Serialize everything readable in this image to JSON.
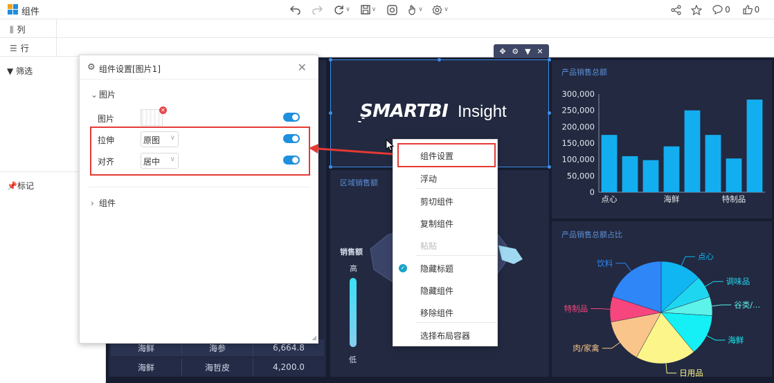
{
  "app": {
    "title": "组件"
  },
  "toolbar": {
    "icons": [
      "undo-icon",
      "redo-icon",
      "refresh-icon",
      "save-icon",
      "screenshot-icon",
      "gesture-icon",
      "settings-icon"
    ],
    "right": {
      "share_icon": "share-icon",
      "star_icon": "star-icon",
      "comments_count": "0",
      "likes_count": "0"
    }
  },
  "fields": {
    "columns_label": "列",
    "rows_label": "行"
  },
  "left_panel": {
    "filter_label": "筛选",
    "marker_label": "标记"
  },
  "dialog": {
    "title": "组件设置[图片1]",
    "section_image": "图片",
    "prop_image": "图片",
    "prop_stretch": "拉伸",
    "stretch_value": "原图",
    "prop_align": "对齐",
    "align_value": "居中",
    "section_component": "组件"
  },
  "context_menu": {
    "items": [
      {
        "label": "组件设置",
        "disabled": false,
        "checked": false
      },
      {
        "label": "浮动",
        "disabled": false,
        "checked": false
      },
      {
        "label": "剪切组件",
        "disabled": false,
        "checked": false
      },
      {
        "label": "复制组件",
        "disabled": false,
        "checked": false
      },
      {
        "label": "粘贴",
        "disabled": true,
        "checked": false
      },
      {
        "label": "隐藏标题",
        "disabled": false,
        "checked": true
      },
      {
        "label": "隐藏组件",
        "disabled": false,
        "checked": false
      },
      {
        "label": "移除组件",
        "disabled": false,
        "checked": false
      },
      {
        "label": "选择布局容器",
        "disabled": false,
        "checked": false
      }
    ]
  },
  "logo_panel": {
    "brand": "SMARTBI",
    "product": "Insight"
  },
  "table": {
    "rows": [
      {
        "category": "海鲜",
        "product": "海参",
        "value": "6,664.8"
      },
      {
        "category": "海鲜",
        "product": "海哲皮",
        "value": "4,200.0"
      }
    ]
  },
  "map_panel": {
    "title": "区域销售额",
    "legend_title": "销售额",
    "legend_high": "高",
    "legend_low": "低"
  },
  "bar_panel": {
    "title": "产品销售总额"
  },
  "pie_panel": {
    "title": "产品销售总额占比"
  },
  "colors": {
    "accent": "#1f8fde",
    "highlight": "#e53935",
    "canvas": "#171d30",
    "panel": "#222940",
    "bar": "#13aef0"
  },
  "chart_data": [
    {
      "type": "bar",
      "title": "产品销售总额",
      "tick_labels_x": [
        "点心",
        "海鲜",
        "特制品"
      ],
      "values": [
        175000,
        110000,
        98000,
        140000,
        250000,
        175000,
        103000,
        283000
      ],
      "ylim": [
        0,
        300000
      ],
      "yticks": [
        "0",
        "50,000",
        "100,000",
        "150,000",
        "200,000",
        "250,000",
        "300,000"
      ],
      "grid": false
    },
    {
      "type": "pie",
      "title": "产品销售总额占比",
      "slices": [
        {
          "label": "点心",
          "value": 13,
          "color": "#10b6f2"
        },
        {
          "label": "调味品",
          "value": 7,
          "color": "#1fd6f0"
        },
        {
          "label": "谷类/...",
          "value": 6,
          "color": "#5df2ea"
        },
        {
          "label": "海鲜",
          "value": 13,
          "color": "#14f0f5"
        },
        {
          "label": "日用品",
          "value": 19,
          "color": "#fbf58a"
        },
        {
          "label": "肉/家禽",
          "value": 14,
          "color": "#fac58a"
        },
        {
          "label": "特制品",
          "value": 8,
          "color": "#f7467e"
        },
        {
          "label": "饮料",
          "value": 20,
          "color": "#2f86f7"
        }
      ]
    }
  ]
}
